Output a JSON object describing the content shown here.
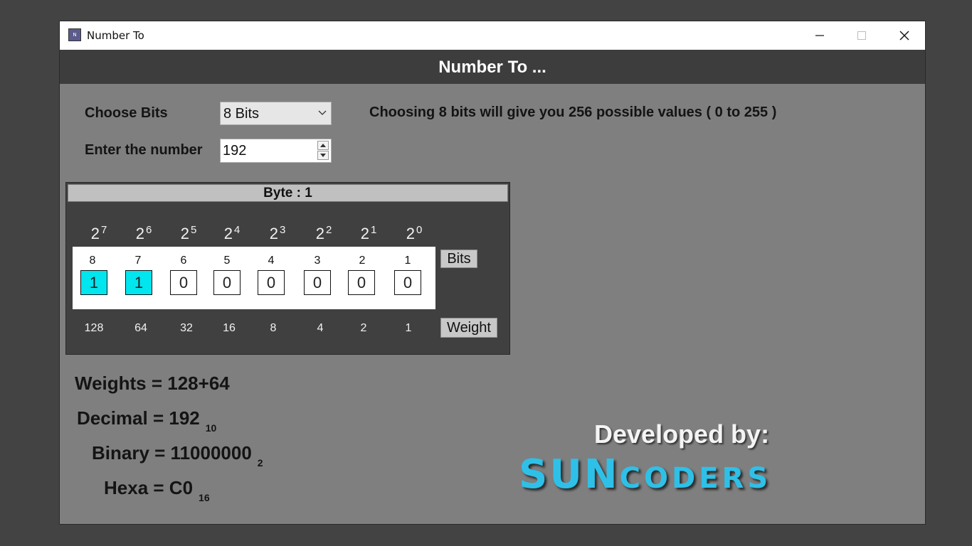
{
  "window": {
    "title": "Number To"
  },
  "header": {
    "title": "Number To ..."
  },
  "form": {
    "bits_label": "Choose Bits",
    "bits_value": "8 Bits",
    "number_label": "Enter the number",
    "number_value": "192",
    "info": "Choosing 8 bits will give you 256 possible values ( 0 to 255 )"
  },
  "byte": {
    "title": "Byte : 1",
    "base": "2",
    "exponents": [
      "7",
      "6",
      "5",
      "4",
      "3",
      "2",
      "1",
      "0"
    ],
    "positions": [
      "8",
      "7",
      "6",
      "5",
      "4",
      "3",
      "2",
      "1"
    ],
    "bits": [
      "1",
      "1",
      "0",
      "0",
      "0",
      "0",
      "0",
      "0"
    ],
    "weights": [
      "128",
      "64",
      "32",
      "16",
      "8",
      "4",
      "2",
      "1"
    ],
    "bits_button": "Bits",
    "weight_button": "Weight"
  },
  "results": {
    "weights": "Weights = 128+64",
    "decimal": "Decimal = 192",
    "decimal_base": "10",
    "binary": "Binary = 11000000",
    "binary_base": "2",
    "hexa": "Hexa = C0",
    "hexa_base": "16"
  },
  "credits": {
    "developed_by": "Developed by:",
    "brand_part1": "SUN",
    "brand_part2": "CODERS"
  },
  "colors": {
    "bit_on": "#00e5ee",
    "header_bg": "#3d3d3d",
    "panel_bg": "#7f7f7f",
    "brand": "#2fc0e8"
  }
}
